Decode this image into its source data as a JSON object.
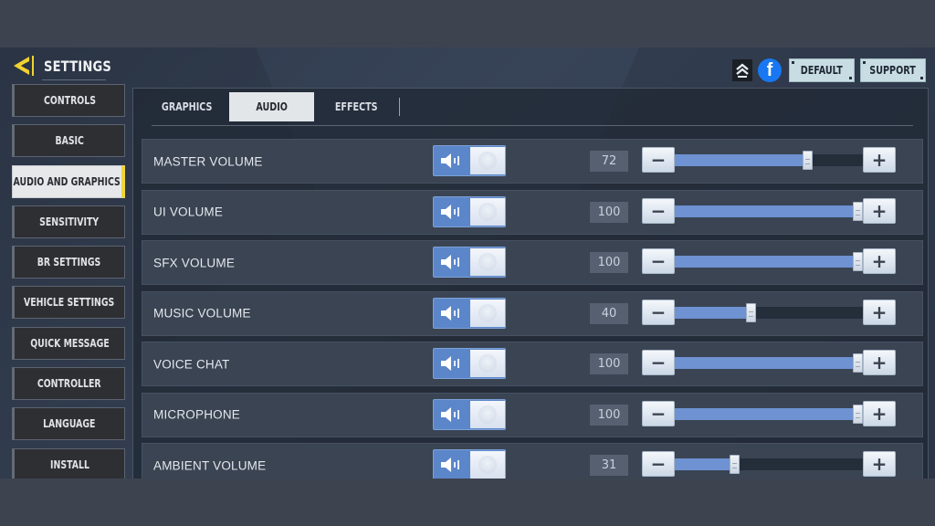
{
  "header": {
    "title": "SETTINGS",
    "back_icon": "back-arrow-icon",
    "rank_icon": "rank-chevrons-icon",
    "facebook_icon": "facebook-icon",
    "facebook_glyph": "f",
    "default_label": "DEFAULT",
    "support_label": "SUPPORT"
  },
  "sidebar": {
    "items": [
      {
        "label": "CONTROLS",
        "active": false
      },
      {
        "label": "BASIC",
        "active": false
      },
      {
        "label": "AUDIO AND GRAPHICS",
        "active": true
      },
      {
        "label": "SENSITIVITY",
        "active": false
      },
      {
        "label": "BR SETTINGS",
        "active": false
      },
      {
        "label": "VEHICLE SETTINGS",
        "active": false
      },
      {
        "label": "QUICK MESSAGE",
        "active": false
      },
      {
        "label": "CONTROLLER",
        "active": false
      },
      {
        "label": "LANGUAGE",
        "active": false
      },
      {
        "label": "INSTALL",
        "active": false
      }
    ],
    "accent_color": "#f1d534"
  },
  "tabs": [
    {
      "label": "GRAPHICS",
      "active": false
    },
    {
      "label": "AUDIO",
      "active": true
    },
    {
      "label": "EFFECTS",
      "active": false
    }
  ],
  "audio_settings": [
    {
      "label": "MASTER VOLUME",
      "enabled": true,
      "value": "72",
      "percent": 72
    },
    {
      "label": "UI VOLUME",
      "enabled": true,
      "value": "100",
      "percent": 100
    },
    {
      "label": "SFX VOLUME",
      "enabled": true,
      "value": "100",
      "percent": 100
    },
    {
      "label": "MUSIC VOLUME",
      "enabled": true,
      "value": "40",
      "percent": 40
    },
    {
      "label": "VOICE CHAT",
      "enabled": true,
      "value": "100",
      "percent": 100
    },
    {
      "label": "MICROPHONE",
      "enabled": true,
      "value": "100",
      "percent": 100
    },
    {
      "label": "AMBIENT VOLUME",
      "enabled": true,
      "value": "31",
      "percent": 31
    }
  ],
  "controls": {
    "minus_glyph": "−",
    "plus_glyph": "+",
    "speaker_icon": "speaker-icon"
  },
  "colors": {
    "slider_fill": "#6e92d2",
    "toggle_on": "#5b86c9",
    "active_tab_bg": "#e3e6e9"
  }
}
